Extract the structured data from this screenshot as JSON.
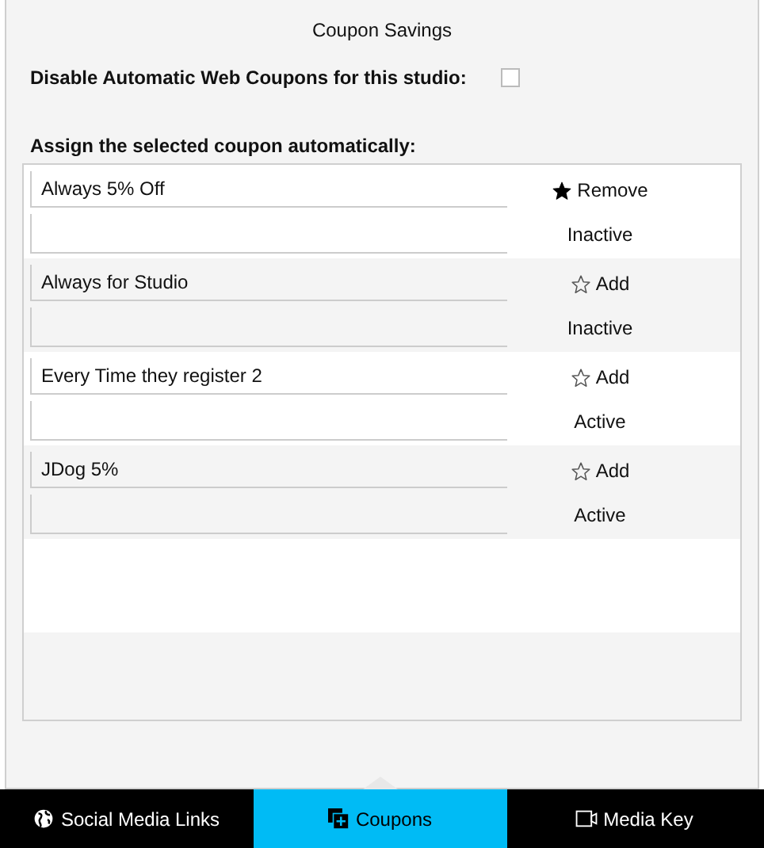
{
  "popover": {
    "title": "Coupon Savings",
    "disable_option": {
      "label": "Disable Automatic Web Coupons for this studio:",
      "checked": false
    },
    "list_heading": "Assign the selected coupon automatically:",
    "coupons": [
      {
        "name": "Always 5% Off",
        "assigned": true,
        "action": "Remove",
        "status": "Inactive"
      },
      {
        "name": "Always for Studio",
        "assigned": false,
        "action": "Add",
        "status": "Inactive"
      },
      {
        "name": "Every Time they register 2",
        "assigned": false,
        "action": "Add",
        "status": "Active"
      },
      {
        "name": "JDog 5%",
        "assigned": false,
        "action": "Add",
        "status": "Active"
      }
    ]
  },
  "tabs": [
    {
      "label": "Social Media Links",
      "kind": "globe",
      "selected": false
    },
    {
      "label": "Coupons",
      "kind": "coupons",
      "selected": true
    },
    {
      "label": "Media Key",
      "kind": "video",
      "selected": false
    }
  ]
}
